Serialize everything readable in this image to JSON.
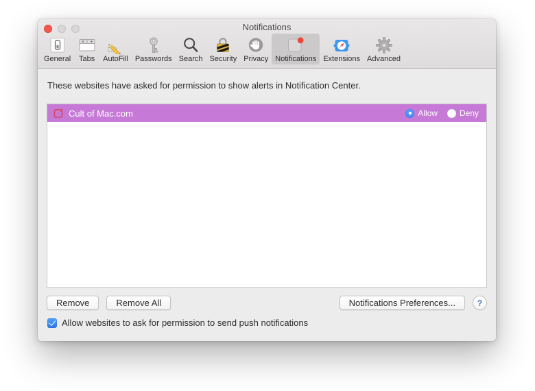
{
  "window": {
    "title": "Notifications",
    "traffic_lights": [
      "close",
      "minimize",
      "zoom"
    ]
  },
  "toolbar": {
    "items": [
      {
        "label": "General",
        "icon": "general-icon",
        "selected": false
      },
      {
        "label": "Tabs",
        "icon": "tabs-icon",
        "selected": false
      },
      {
        "label": "AutoFill",
        "icon": "autofill-icon",
        "selected": false
      },
      {
        "label": "Passwords",
        "icon": "passwords-icon",
        "selected": false
      },
      {
        "label": "Search",
        "icon": "search-icon",
        "selected": false
      },
      {
        "label": "Security",
        "icon": "security-icon",
        "selected": false
      },
      {
        "label": "Privacy",
        "icon": "privacy-icon",
        "selected": false
      },
      {
        "label": "Notifications",
        "icon": "notifications-icon",
        "selected": true
      },
      {
        "label": "Extensions",
        "icon": "extensions-icon",
        "selected": false
      },
      {
        "label": "Advanced",
        "icon": "advanced-icon",
        "selected": false
      }
    ]
  },
  "content": {
    "description": "These websites have asked for permission to show alerts in Notification Center.",
    "list": {
      "rows": [
        {
          "site": "Cult of Mac.com",
          "options": [
            "Allow",
            "Deny"
          ],
          "selected_option": "Allow"
        }
      ]
    },
    "buttons": {
      "remove": "Remove",
      "remove_all": "Remove All",
      "notifications_preferences": "Notifications Preferences...",
      "help": "?"
    },
    "checkbox": {
      "label": "Allow websites to ask for permission to send push notifications",
      "checked": true
    }
  },
  "colors": {
    "row_highlight": "#c679d6",
    "radio_selected": "#2f7bf0",
    "checkbox_blue": "#2d78ef",
    "selected_tab_bg": "#cbc9ca",
    "badge_red": "#f0453c"
  }
}
